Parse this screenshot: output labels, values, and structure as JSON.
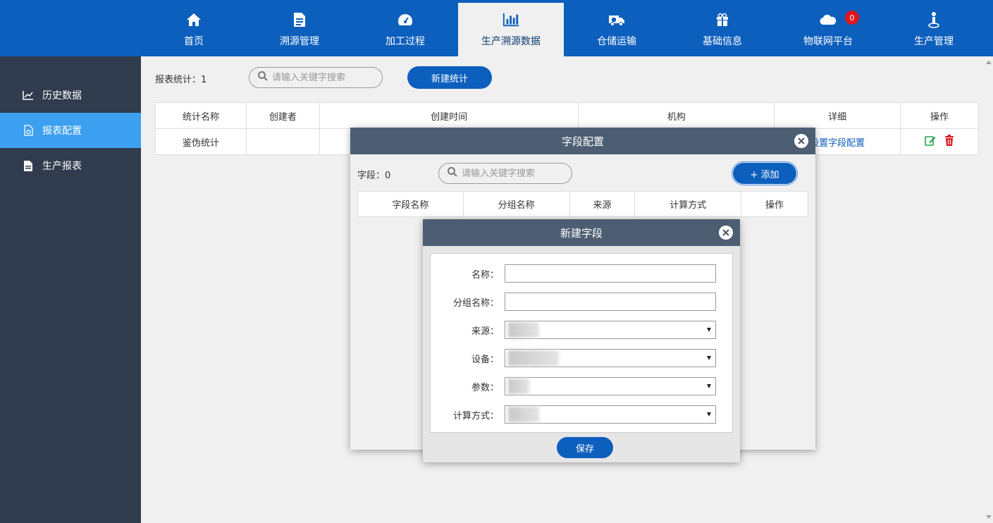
{
  "nav": {
    "items": [
      {
        "label": "首页",
        "icon": "home-icon"
      },
      {
        "label": "溯源管理",
        "icon": "document-icon"
      },
      {
        "label": "加工过程",
        "icon": "dashboard-icon"
      },
      {
        "label": "生产溯源数据",
        "icon": "bar-chart-icon"
      },
      {
        "label": "仓储运输",
        "icon": "ambulance-icon"
      },
      {
        "label": "基础信息",
        "icon": "gift-icon"
      },
      {
        "label": "物联网平台",
        "icon": "cloud-icon"
      },
      {
        "label": "生产管理",
        "icon": "person-pin-icon"
      }
    ],
    "active_index": 3,
    "iot_badge": "0"
  },
  "sidebar": {
    "items": [
      {
        "label": "历史数据",
        "icon": "line-chart-icon"
      },
      {
        "label": "报表配置",
        "icon": "file-settings-icon"
      },
      {
        "label": "生产报表",
        "icon": "file-text-icon"
      }
    ],
    "active_index": 1
  },
  "main": {
    "stat_label": "报表统计：1",
    "search_placeholder": "请输入关键字搜索",
    "new_button": "新建统计",
    "table": {
      "headers": [
        "统计名称",
        "创建者",
        "创建时间",
        "机构",
        "详细",
        "操作"
      ],
      "rows": [
        {
          "name": "鉴伪统计",
          "creator": "",
          "created": "",
          "org": "",
          "detail": "设置字段配置"
        }
      ]
    }
  },
  "field_dialog": {
    "title": "字段配置",
    "count_label": "字段：0",
    "search_placeholder": "请输入关键字搜索",
    "add_button": "+ 添加",
    "headers": [
      "字段名称",
      "分组名称",
      "来源",
      "计算方式",
      "操作"
    ]
  },
  "new_field_dialog": {
    "title": "新建字段",
    "labels": {
      "name": "名称：",
      "group": "分组名称：",
      "source": "来源：",
      "device": "设备：",
      "param": "参数：",
      "calc": "计算方式："
    },
    "values": {
      "name": "",
      "group": ""
    },
    "save_button": "保存"
  },
  "colors": {
    "primary": "#0d5fbd",
    "sidebar": "#303b4d",
    "sidebar_active": "#3d9ff0",
    "dialog_header": "#4d5e73",
    "badge": "#e0151d",
    "edit": "#22a24a",
    "delete": "#e0151d"
  }
}
